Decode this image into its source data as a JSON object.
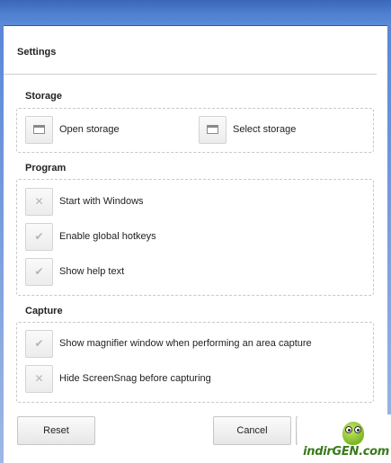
{
  "header": {
    "title": "Settings"
  },
  "storage": {
    "title": "Storage",
    "open_label": "Open storage",
    "select_label": "Select storage"
  },
  "program": {
    "title": "Program",
    "items": [
      {
        "label": "Start with Windows",
        "state": "off",
        "icon": "x-icon"
      },
      {
        "label": "Enable global hotkeys",
        "state": "on",
        "icon": "checkmark-icon"
      },
      {
        "label": "Show help text",
        "state": "on",
        "icon": "checkmark-icon"
      }
    ]
  },
  "capture": {
    "title": "Capture",
    "items": [
      {
        "label": "Show magnifier window when performing an area capture",
        "state": "on",
        "icon": "checkmark-icon"
      },
      {
        "label": "Hide ScreenSnag before capturing",
        "state": "off",
        "icon": "x-icon"
      }
    ]
  },
  "footer": {
    "reset_label": "Reset",
    "cancel_label": "Cancel",
    "ok_label": ""
  },
  "watermark": {
    "text": "indirGEN.com"
  },
  "colors": {
    "titlebar": "#4f7fd0",
    "check_mark": "#b5b5b5",
    "watermark_green": "#3a7a1c"
  }
}
